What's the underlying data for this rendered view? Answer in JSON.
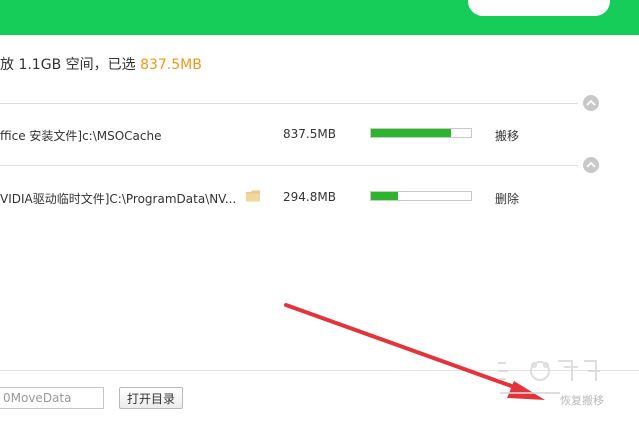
{
  "summary": {
    "prefix": "放 1.1GB 空间，已选 ",
    "selected": "837.5MB"
  },
  "rows": [
    {
      "name": "ffice 安装文件]c:\\MSOCache",
      "size": "837.5MB",
      "progress": 0.8,
      "action": "搬移"
    },
    {
      "name": "VIDIA驱动临时文件]C:\\ProgramData\\NV...",
      "size": "294.8MB",
      "progress": 0.27,
      "action": "删除"
    }
  ],
  "footer": {
    "path_value": "0MoveData",
    "open_dir_label": "打开目录",
    "restore_label": "恢复搬移"
  },
  "colors": {
    "header": "#16cd5a",
    "highlight": "#f0961a",
    "progress": "#2cb52c",
    "arrow": "#e2343a"
  }
}
